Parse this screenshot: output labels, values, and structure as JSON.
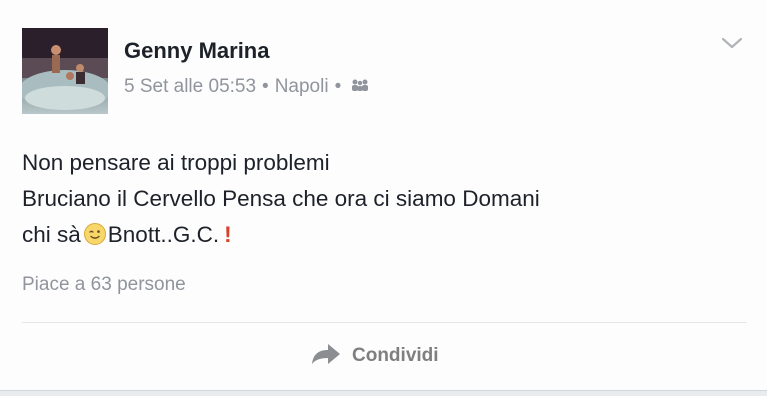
{
  "post": {
    "author": "Genny Marina",
    "date": "5 Set alle 05:53",
    "separator": "•",
    "location": "Napoli",
    "audience_icon": "friends-icon",
    "text_lines": {
      "line1": "Non pensare ai troppi problemi",
      "line2": "Bruciano il Cervello Pensa che ora ci siamo Domani",
      "line3_start": "chi sà",
      "line3_end": "Bnott..G.C.",
      "emoji": "wink-emoji",
      "exclamation": "!"
    },
    "likes": "Piace a 63 persone",
    "share_label": "Condividi",
    "menu_icon": "chevron-down-icon"
  },
  "colors": {
    "name_text": "#1d2129",
    "meta_text": "#90949c",
    "exclamation": "#d9402a",
    "share_text": "#7f7f7f"
  }
}
